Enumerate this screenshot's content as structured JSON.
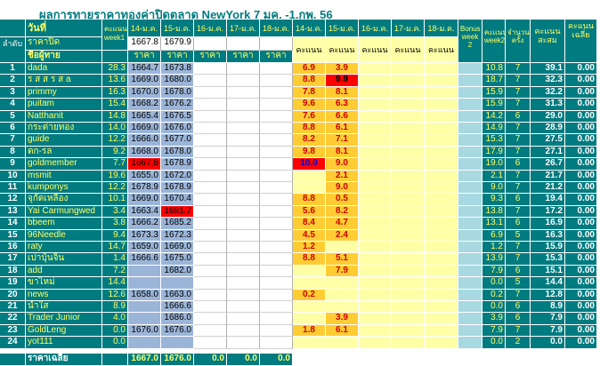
{
  "title": "ผลการทายราคาทองค่าปิดตลาด NewYork 7 มค. -1.กพ. 56",
  "header": {
    "wanti": "วันที่",
    "lamdap": "ลำดับ",
    "rakapit": "ราคาปิด",
    "chuphutai": "ชื่อผู้ทาย",
    "kanaen_week1": "คะแนน week1",
    "dates_price": [
      "14-ม.ค.",
      "15-ม.ค.",
      "16-ม.ค.",
      "17-ม.ค.",
      "18-ม.ค."
    ],
    "close_prices": [
      "1667.8",
      "1679.9",
      "",
      "",
      ""
    ],
    "raka": "ราคา",
    "dates_score": [
      "14-ม.ค.",
      "15-ม.ค.",
      "16-ม.ค.",
      "17-ม.ค.",
      "18-ม.ค."
    ],
    "kanaen": "คะแนน",
    "bonus": "Bonus week 2",
    "kanaen_week2": "คะแนน week2",
    "jamnuan_khrang": "จำนวนครั้ง",
    "kanaen_sasom": "คะแนน สะสม",
    "kanaen_liea": "คะแนน เฉลี่ย"
  },
  "rows": [
    {
      "no": "1",
      "name": "dada",
      "w1": "28.3",
      "p1": "1664.7",
      "p2": "1673.8",
      "s1": "6.9",
      "s2": "3.9",
      "w2": "10.8",
      "cnt": "7",
      "total": "39.1",
      "avg": "0.00"
    },
    {
      "no": "2",
      "name": "ร ส ส ร ส a",
      "w1": "13.6",
      "p1": "1669.0",
      "p2": "1680.0",
      "s1": "8.8",
      "s2": "9.9",
      "w2": "18.7",
      "cnt": "7",
      "total": "32.3",
      "avg": "0.00"
    },
    {
      "no": "3",
      "name": "primmy",
      "w1": "16.3",
      "p1": "1670.0",
      "p2": "1678.0",
      "s1": "7.8",
      "s2": "8.1",
      "w2": "15.9",
      "cnt": "7",
      "total": "32.2",
      "avg": "0.00"
    },
    {
      "no": "4",
      "name": "puitam",
      "w1": "15.4",
      "p1": "1668.2",
      "p2": "1676.2",
      "s1": "9.6",
      "s2": "6.3",
      "w2": "15.9",
      "cnt": "7",
      "total": "31.3",
      "avg": "0.00"
    },
    {
      "no": "5",
      "name": "Natthanit",
      "w1": "14.8",
      "p1": "1665.4",
      "p2": "1676.5",
      "s1": "7.6",
      "s2": "6.6",
      "w2": "14.2",
      "cnt": "6",
      "total": "29.0",
      "avg": "0.00"
    },
    {
      "no": "6",
      "name": "กระต่ายทอง",
      "w1": "14.0",
      "p1": "1669.0",
      "p2": "1676.0",
      "s1": "8.8",
      "s2": "6.1",
      "w2": "14.9",
      "cnt": "7",
      "total": "28.9",
      "avg": "0.00"
    },
    {
      "no": "7",
      "name": "guide",
      "w1": "12.2",
      "p1": "1666.0",
      "p2": "1677.0",
      "s1": "8.2",
      "s2": "7.1",
      "w2": "15.3",
      "cnt": "7",
      "total": "27.5",
      "avg": "0.00"
    },
    {
      "no": "8",
      "name": "ตก-รล",
      "w1": "9.2",
      "p1": "1668.0",
      "p2": "1678.0",
      "s1": "9.8",
      "s2": "8.1",
      "w2": "17.9",
      "cnt": "7",
      "total": "27.1",
      "avg": "0.00"
    },
    {
      "no": "9",
      "name": "goldmember",
      "w1": "7.7",
      "p1": "1667.8",
      "p2": "1678.9",
      "s1": "10.0",
      "s2": "9.0",
      "w2": "19.0",
      "cnt": "6",
      "total": "26.7",
      "avg": "0.00"
    },
    {
      "no": "10",
      "name": "msmit",
      "w1": "19.6",
      "p1": "1655.0",
      "p2": "1672.0",
      "s1": "",
      "s2": "2.1",
      "w2": "2.1",
      "cnt": "7",
      "total": "21.7",
      "avg": "0.00"
    },
    {
      "no": "11",
      "name": "kumponys",
      "w1": "12.2",
      "p1": "1678.9",
      "p2": "1678.9",
      "s1": "",
      "s2": "9.0",
      "w2": "9.0",
      "cnt": "7",
      "total": "21.2",
      "avg": "0.00"
    },
    {
      "no": "12",
      "name": "จุกัดเหลือง",
      "w1": "10.1",
      "p1": "1669.0",
      "p2": "1670.4",
      "s1": "8.8",
      "s2": "0.5",
      "w2": "9.3",
      "cnt": "6",
      "total": "19.4",
      "avg": "0.00"
    },
    {
      "no": "13",
      "name": "Yai Carmungwed",
      "w1": "3.4",
      "p1": "1663.4",
      "p2": "1681.7",
      "s1": "5.6",
      "s2": "8.2",
      "w2": "13.8",
      "cnt": "7",
      "total": "17.2",
      "avg": "0.00"
    },
    {
      "no": "14",
      "name": "bbeem",
      "w1": "3.8",
      "p1": "1666.2",
      "p2": "1685.2",
      "s1": "8.4",
      "s2": "4.7",
      "w2": "13.1",
      "cnt": "6",
      "total": "16.9",
      "avg": "0.00"
    },
    {
      "no": "15",
      "name": "96Needle",
      "w1": "9.4",
      "p1": "1673.3",
      "p2": "1672.3",
      "s1": "4.5",
      "s2": "2.4",
      "w2": "6.9",
      "cnt": "5",
      "total": "16.3",
      "avg": "0.00"
    },
    {
      "no": "16",
      "name": "raty",
      "w1": "14.7",
      "p1": "1659.0",
      "p2": "1669.0",
      "s1": "1.2",
      "s2": "",
      "w2": "1.2",
      "cnt": "7",
      "total": "15.9",
      "avg": "0.00"
    },
    {
      "no": "17",
      "name": "เปาบุ้นจิ้น",
      "w1": "1.4",
      "p1": "1666.6",
      "p2": "1675.0",
      "s1": "8.8",
      "s2": "5.1",
      "w2": "13.9",
      "cnt": "7",
      "total": "15.3",
      "avg": "0.00"
    },
    {
      "no": "18",
      "name": "add",
      "w1": "7.2",
      "p1": "",
      "p2": "1682.0",
      "s1": "",
      "s2": "7.9",
      "w2": "7.9",
      "cnt": "6",
      "total": "15.1",
      "avg": "0.00"
    },
    {
      "no": "19",
      "name": "ขาไหม่",
      "w1": "14.4",
      "p1": "",
      "p2": "",
      "s1": "",
      "s2": "",
      "w2": "0.0",
      "cnt": "5",
      "total": "14.4",
      "avg": "0.00"
    },
    {
      "no": "20",
      "name": "news",
      "w1": "12.6",
      "p1": "1658.0",
      "p2": "1663.0",
      "s1": "0.2",
      "s2": "",
      "w2": "0.2",
      "cnt": "7",
      "total": "12.8",
      "avg": "0.00"
    },
    {
      "no": "21",
      "name": "น้ำใส",
      "w1": "8.9",
      "p1": "",
      "p2": "1666.6",
      "s1": "",
      "s2": "",
      "w2": "0.0",
      "cnt": "6",
      "total": "8.9",
      "avg": "0.00"
    },
    {
      "no": "22",
      "name": "Trader Junior",
      "w1": "4.0",
      "p1": "",
      "p2": "1686.0",
      "s1": "",
      "s2": "3.9",
      "w2": "3.9",
      "cnt": "6",
      "total": "7.9",
      "avg": "0.00"
    },
    {
      "no": "23",
      "name": "GoldLeng",
      "w1": "0.0",
      "p1": "1676.0",
      "p2": "1676.0",
      "s1": "1.8",
      "s2": "6.1",
      "w2": "7.9",
      "cnt": "7",
      "total": "7.9",
      "avg": "0.00"
    },
    {
      "no": "24",
      "name": "yot111",
      "w1": "0.0",
      "p1": "",
      "p2": "",
      "s1": "",
      "s2": "",
      "w2": "0.0",
      "cnt": "2",
      "total": "0.0",
      "avg": "0.00"
    }
  ],
  "footer": {
    "label": "ราคาเฉลี่ย",
    "values": [
      "1667.0",
      "1676.0",
      "0.0",
      "0.0",
      "0.0"
    ]
  }
}
